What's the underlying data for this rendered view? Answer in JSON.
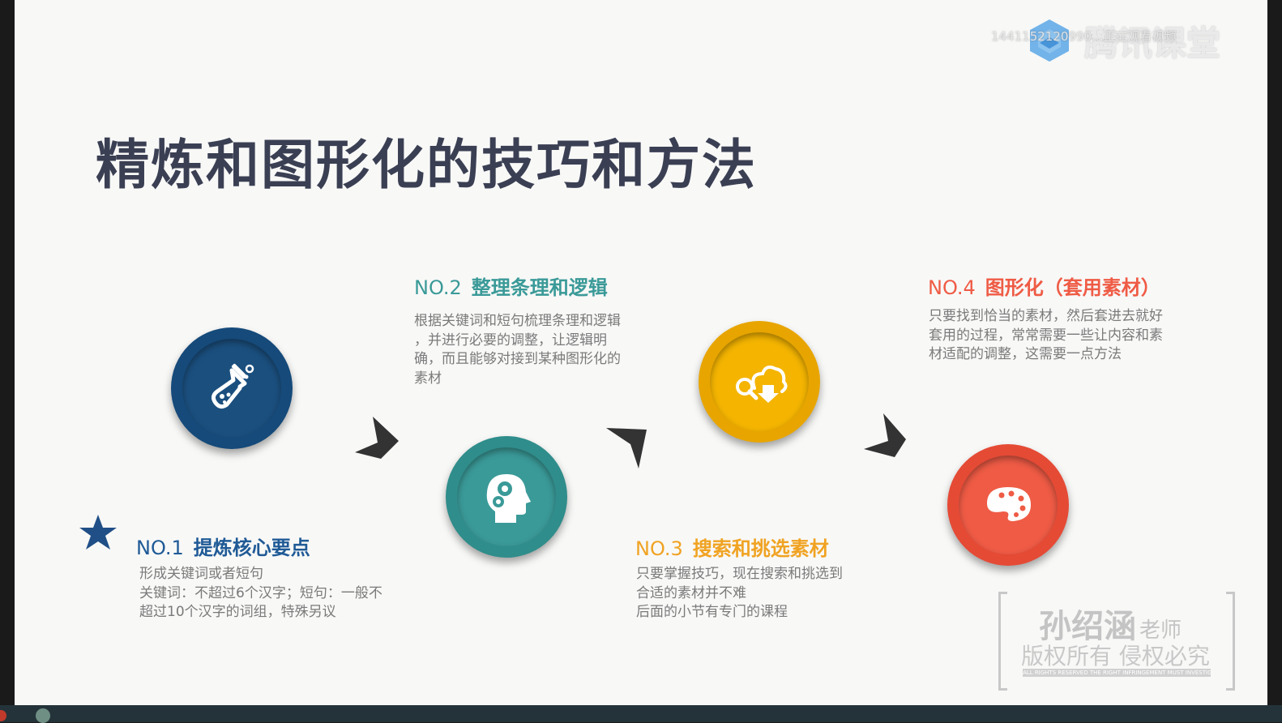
{
  "slide": {
    "title": "精炼和图形化的技巧和方法"
  },
  "logo": {
    "brand": "腾讯课堂",
    "overlay_id": "1441152120990...正在观看视频"
  },
  "steps": [
    {
      "number": "NO.1",
      "name": "提炼核心要点",
      "color": "#1f5a96",
      "icon": "flask-icon",
      "description": "形成关键词或者短句\n关键词：不超过6个汉字；短句：一般不\n超过10个汉字的词组，特殊另议"
    },
    {
      "number": "NO.2",
      "name": "整理条理和逻辑",
      "color": "#3a9a98",
      "icon": "head-gears-icon",
      "description": "根据关键词和短句梳理条理和逻辑\n，并进行必要的调整，让逻辑明\n确，而且能够对接到某种图形化的\n素材"
    },
    {
      "number": "NO.3",
      "name": "搜索和挑选素材",
      "color": "#f0a322",
      "icon": "search-cloud-download-icon",
      "description": "只要掌握技巧，现在搜索和挑选到\n合适的素材并不难\n后面的小节有专门的课程"
    },
    {
      "number": "NO.4",
      "name": "图形化（套用素材）",
      "color": "#ef5b45",
      "icon": "palette-icon",
      "description": "只要找到恰当的素材，然后套进去就好\n套用的过程，常常需要一些让内容和素\n材适配的调整，这需要一点方法"
    }
  ],
  "watermark": {
    "name": "孙绍涵",
    "role": "老师",
    "rights": "版权所有 侵权必究",
    "small": "ALL RIGHTS RESERVED THE RIGHT INFRINGEMENT MUST INVESTIGATE!"
  },
  "colors": {
    "title": "#3a3f53",
    "background": "#f8f8f7",
    "circle1": "#1b4f7e",
    "circle2": "#3a9a98",
    "circle3": "#f4b400",
    "circle4": "#ef5b45",
    "arrow": "#333333"
  }
}
